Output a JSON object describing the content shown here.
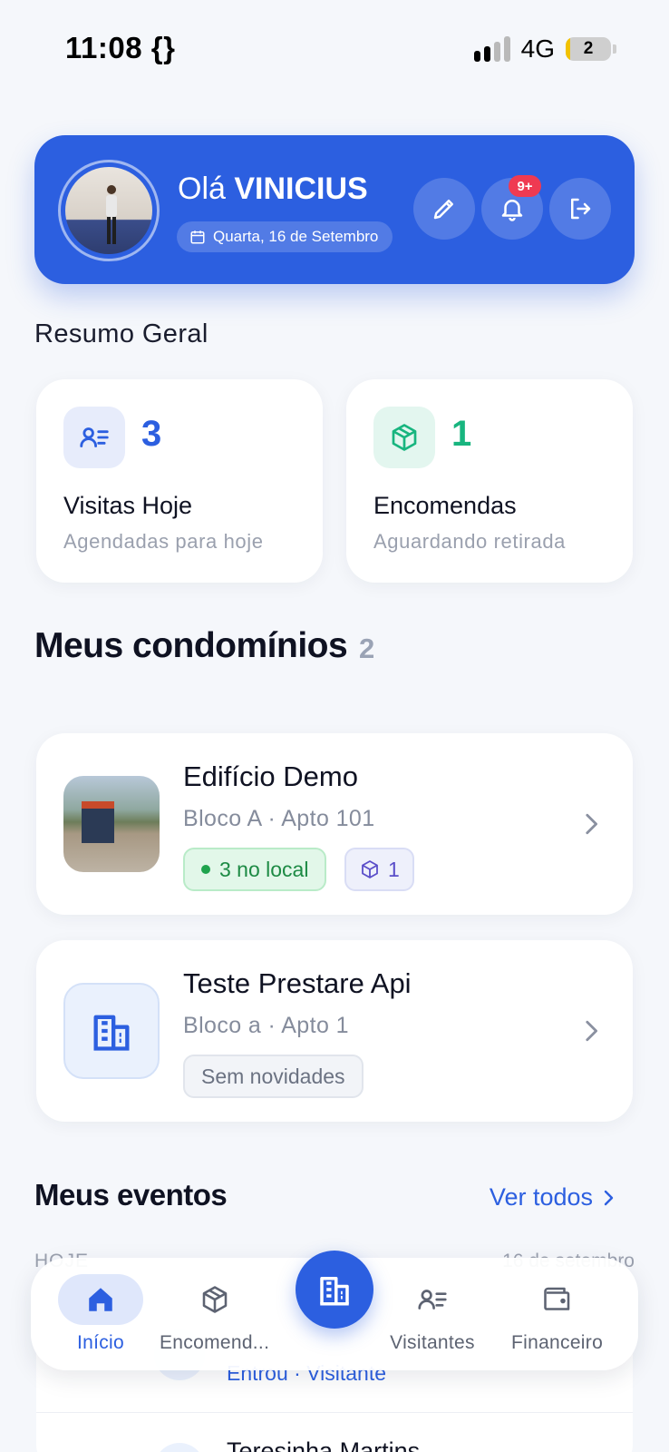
{
  "status_bar": {
    "time": "11:08 {}",
    "network": "4G",
    "battery": "2"
  },
  "header": {
    "greeting": "Olá",
    "user_name": "VINICIUS",
    "date": "Quarta, 16 de Setembro",
    "notifications_badge": "9+"
  },
  "summary": {
    "title": "Resumo Geral",
    "visits": {
      "value": "3",
      "title": "Visitas Hoje",
      "subtitle": "Agendadas para hoje"
    },
    "orders": {
      "value": "1",
      "title": "Encomendas",
      "subtitle": "Aguardando retirada"
    }
  },
  "condos": {
    "title": "Meus condomínios",
    "count": "2",
    "items": [
      {
        "name": "Edifício Demo",
        "unit": "Bloco A · Apto 101",
        "status_label": "3 no local",
        "packages": "1"
      },
      {
        "name": "Teste Prestare Api",
        "unit": "Bloco a · Apto 1",
        "status_label": "Sem novidades"
      }
    ]
  },
  "events": {
    "title": "Meus eventos",
    "see_all": "Ver todos",
    "day_label": "HOJE",
    "date_label": "16 de setembro",
    "items": [
      {
        "subtitle": "Entrou · Visitante"
      },
      {
        "name": "Teresinha Martins"
      }
    ]
  },
  "nav": {
    "home": "Início",
    "orders": "Encomend...",
    "visitors": "Visitantes",
    "finance": "Financeiro"
  },
  "colors": {
    "primary": "#2c5fe0",
    "success": "#18b57f",
    "badge": "#ef3a52"
  }
}
